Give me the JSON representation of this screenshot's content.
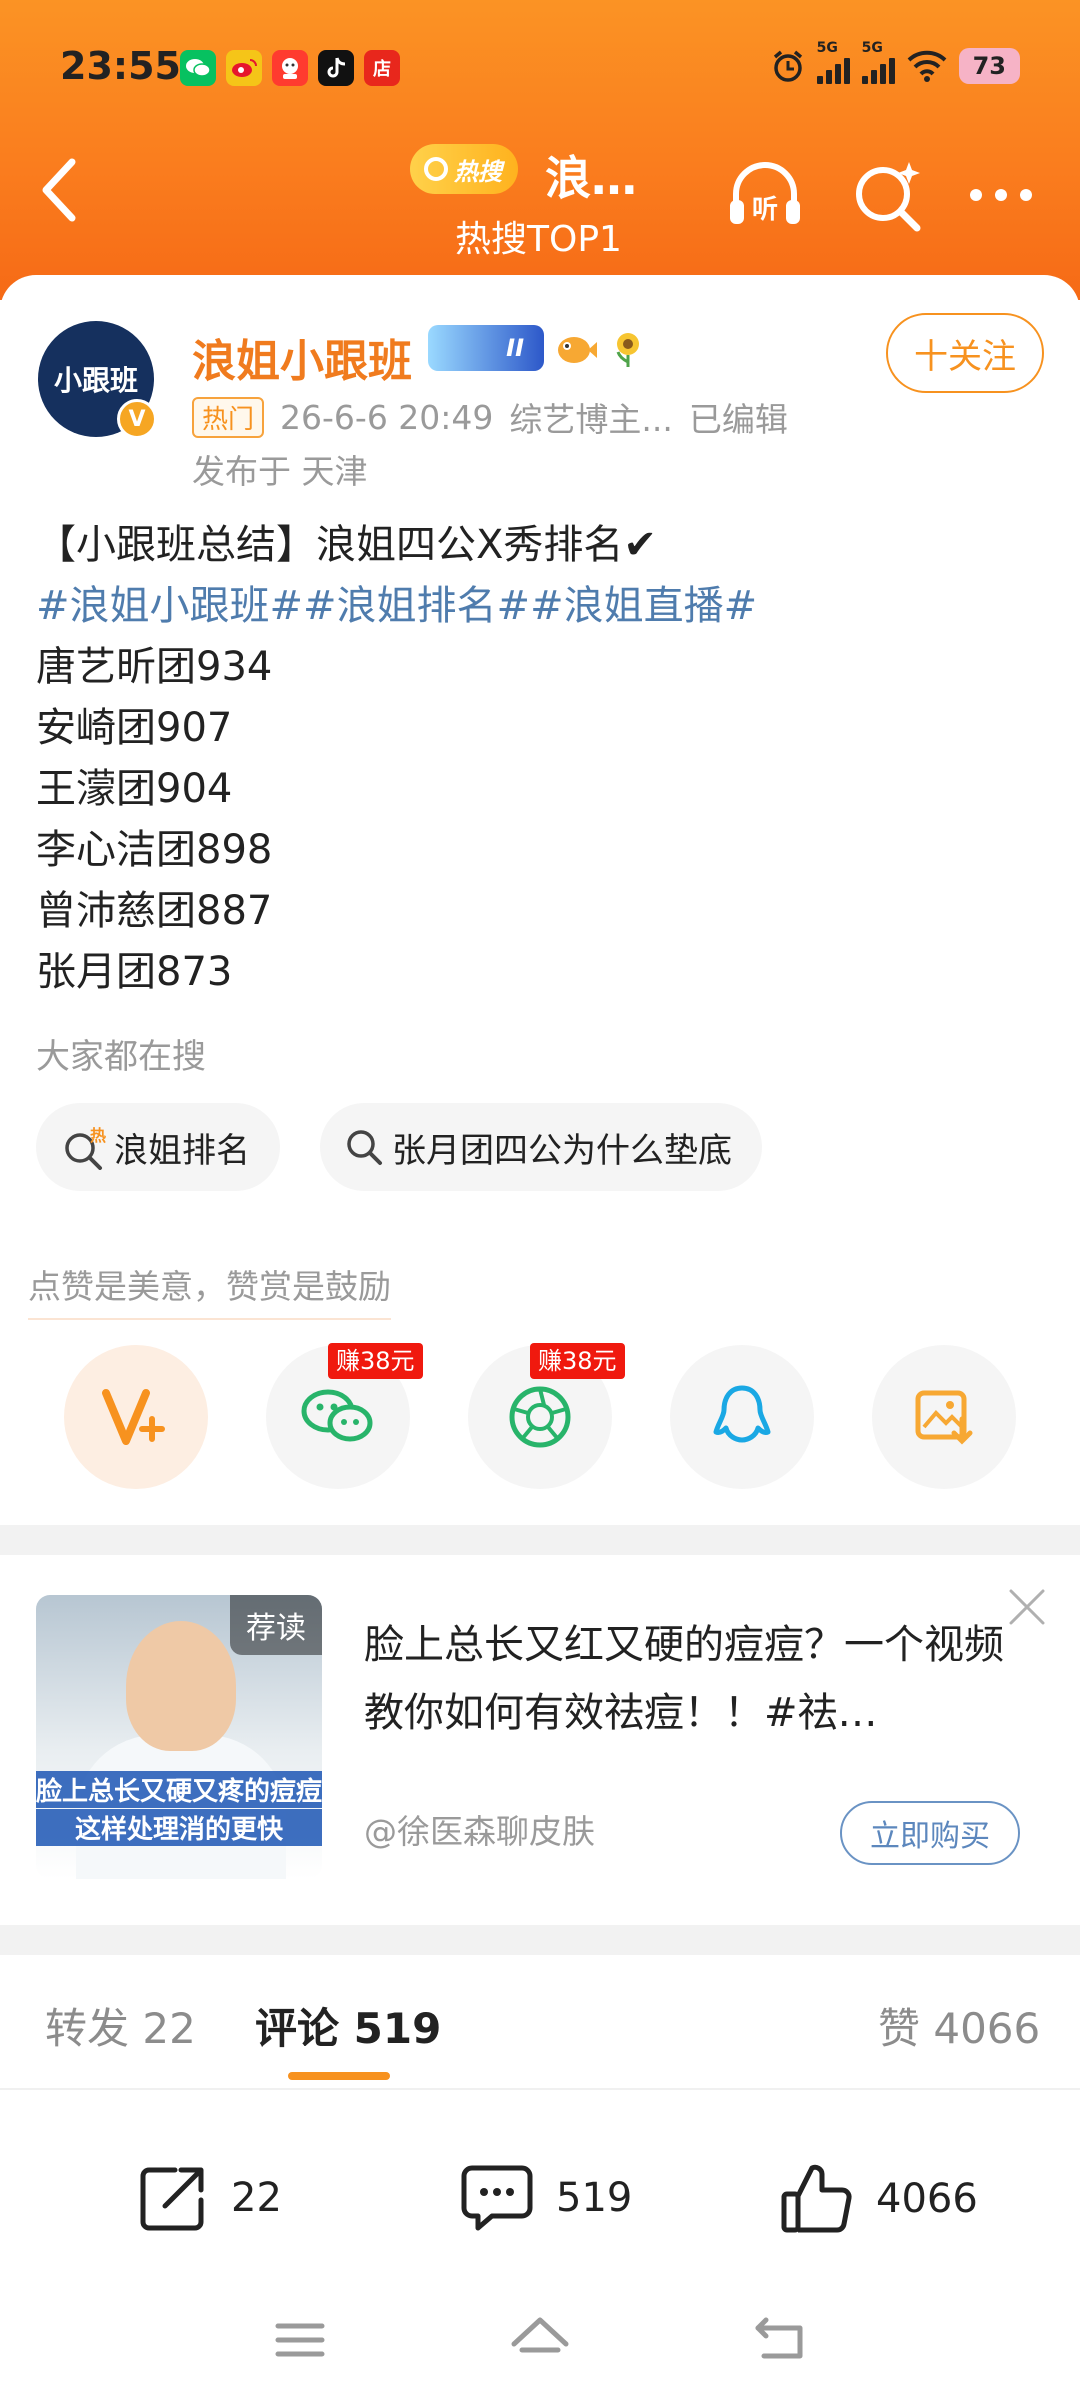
{
  "status_bar": {
    "time": "23:55",
    "battery": "73",
    "network_1": "5G",
    "network_2": "5G",
    "app_icons": [
      "wechat-icon",
      "weibo-icon",
      "taobao-icon",
      "tiktok-icon",
      "shop-icon"
    ],
    "shop_label": "店"
  },
  "nav": {
    "hot_tag": "热搜",
    "title": "浪…",
    "subtitle": "热搜TOP1"
  },
  "post": {
    "username": "浪姐小跟班",
    "avatar_text": "小跟班",
    "level_badge": "II",
    "follow_label": "十关注",
    "hot_tag": "热门",
    "timestamp": "26-6-6 20:49",
    "category": "综艺博主...",
    "edited": "已编辑",
    "location": "发布于 天津",
    "headline": "【小跟班总结】浪姐四公X秀排名✔",
    "hashtags": [
      "#浪姐小跟班#",
      "#浪姐排名#",
      "#浪姐直播#"
    ],
    "rankings": [
      "唐艺昕团934",
      "安崎团907",
      "王濛团904",
      "李心洁团898",
      "曾沛慈团887",
      "张月团873"
    ]
  },
  "search": {
    "label": "大家都在搜",
    "chips": [
      "浪姐排名",
      "张月团四公为什么垫底"
    ],
    "hot_mark": "热"
  },
  "reward": {
    "text": "点赞是美意，赞赏是鼓励",
    "earn_tags": [
      "赚38元",
      "赚38元"
    ]
  },
  "ad": {
    "tag": "荐读",
    "caption_1": "脸上总长又硬又疼的痘痘",
    "caption_2": "这样处理消的更快",
    "title": "脸上总长又红又硬的痘痘？一个视频教你如何有效祛痘！！#祛…",
    "author": "@徐医森聊皮肤",
    "buy_label": "立即购买"
  },
  "tabs": {
    "repost": "转发 22",
    "comments": "评论 519",
    "likes": "赞 4066"
  },
  "actions": {
    "share_count": "22",
    "comment_count": "519",
    "like_count": "4066"
  },
  "colors": {
    "accent": "#f7921f",
    "header_orange": "#fa7d1e",
    "hashtag": "#4f7cad",
    "earn_red": "#f0190e"
  }
}
